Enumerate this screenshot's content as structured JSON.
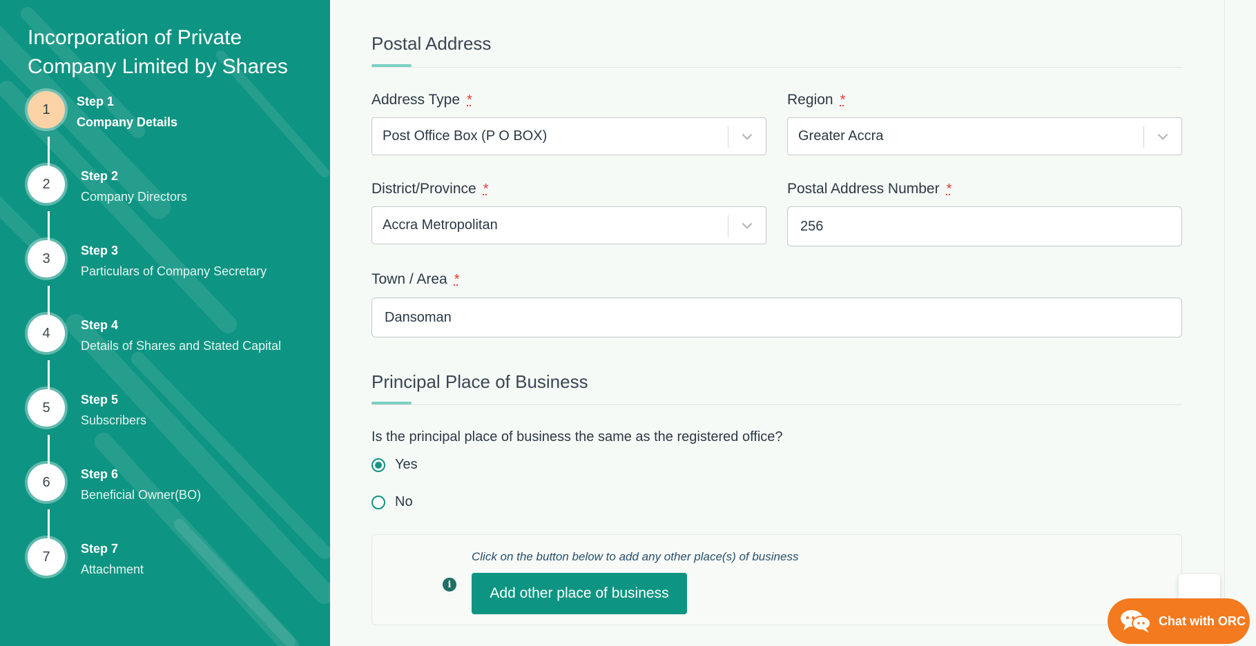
{
  "sidebar": {
    "title": "Incorporation of Private Company Limited by Shares",
    "steps": [
      {
        "number": "1",
        "step": "Step 1",
        "name": "Company Details",
        "active": true
      },
      {
        "number": "2",
        "step": "Step 2",
        "name": "Company Directors",
        "active": false
      },
      {
        "number": "3",
        "step": "Step 3",
        "name": "Particulars of Company Secretary",
        "active": false
      },
      {
        "number": "4",
        "step": "Step 4",
        "name": "Details of Shares and Stated Capital",
        "active": false
      },
      {
        "number": "5",
        "step": "Step 5",
        "name": "Subscribers",
        "active": false
      },
      {
        "number": "6",
        "step": "Step 6",
        "name": "Beneficial Owner(BO)",
        "active": false
      },
      {
        "number": "7",
        "step": "Step 7",
        "name": "Attachment",
        "active": false
      }
    ]
  },
  "postal": {
    "title": "Postal Address",
    "address_type": {
      "label": "Address Type",
      "required": "*",
      "value": "Post Office Box (P O BOX)"
    },
    "region": {
      "label": "Region",
      "required": "*",
      "value": "Greater Accra"
    },
    "district": {
      "label": "District/Province",
      "required": "*",
      "value": "Accra Metropolitan"
    },
    "postal_number": {
      "label": "Postal Address Number",
      "required": "*",
      "value": "256"
    },
    "town": {
      "label": "Town / Area",
      "required": "*",
      "value": "Dansoman"
    }
  },
  "business": {
    "title": "Principal Place of Business",
    "question": "Is the principal place of business the same as the registered office?",
    "options": [
      {
        "label": "Yes",
        "checked": true
      },
      {
        "label": "No",
        "checked": false
      }
    ],
    "info_text": "Click on the button below to add any other place(s) of business",
    "add_button": "Add other place of business"
  },
  "chat": {
    "label": "Chat with ORC"
  },
  "colors": {
    "brand": "#0e9482",
    "active_step": "#fbd3a6",
    "chat": "#f47a1f",
    "required": "#e53935"
  }
}
